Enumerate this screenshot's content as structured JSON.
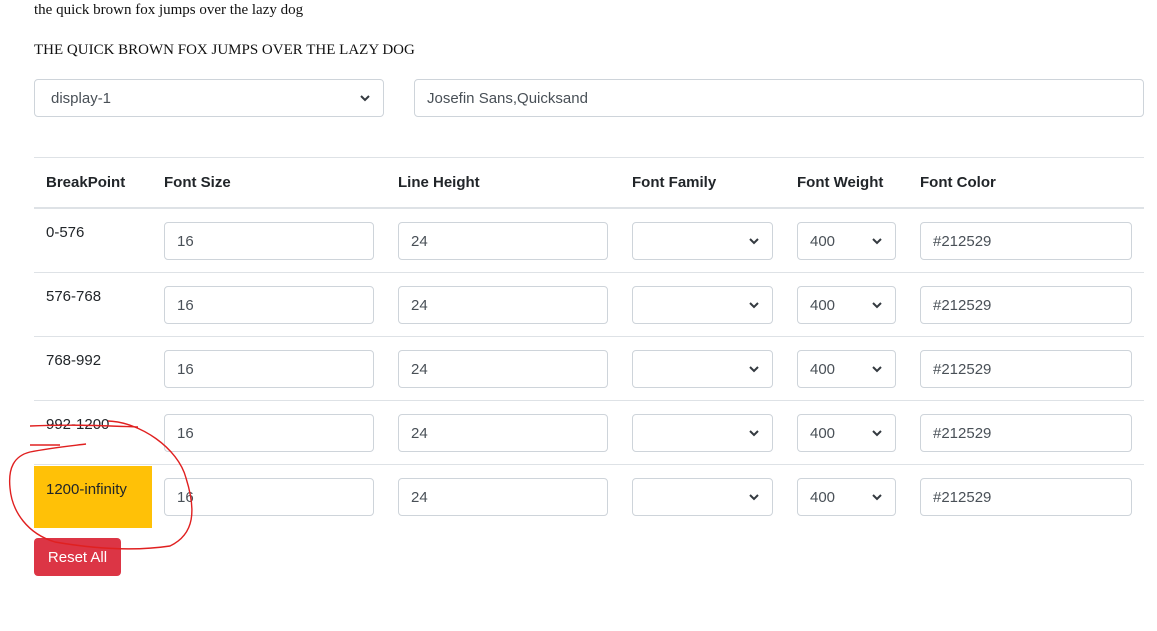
{
  "samples": {
    "lower": "the quick brown fox jumps over the lazy dog",
    "upper": "THE QUICK BROWN FOX JUMPS OVER THE LAZY DOG"
  },
  "controls": {
    "class_select_value": "display-1",
    "font_family_value": "Josefin Sans,Quicksand"
  },
  "table": {
    "headers": [
      "BreakPoint",
      "Font Size",
      "Line Height",
      "Font Family",
      "Font Weight",
      "Font Color"
    ],
    "rows": [
      {
        "breakpoint": "0-576",
        "font_size": "16",
        "line_height": "24",
        "font_family": "",
        "font_weight": "400",
        "font_color": "#212529"
      },
      {
        "breakpoint": "576-768",
        "font_size": "16",
        "line_height": "24",
        "font_family": "",
        "font_weight": "400",
        "font_color": "#212529"
      },
      {
        "breakpoint": "768-992",
        "font_size": "16",
        "line_height": "24",
        "font_family": "",
        "font_weight": "400",
        "font_color": "#212529"
      },
      {
        "breakpoint": "992-1200",
        "font_size": "16",
        "line_height": "24",
        "font_family": "",
        "font_weight": "400",
        "font_color": "#212529"
      },
      {
        "breakpoint": "1200-infinity",
        "font_size": "16",
        "line_height": "24",
        "font_family": "",
        "font_weight": "400",
        "font_color": "#212529"
      }
    ],
    "highlighted_row_color": "#ffc107"
  },
  "actions": {
    "reset_label": "Reset All",
    "reset_color": "#dc3545"
  },
  "annotation_color": "#e02020"
}
